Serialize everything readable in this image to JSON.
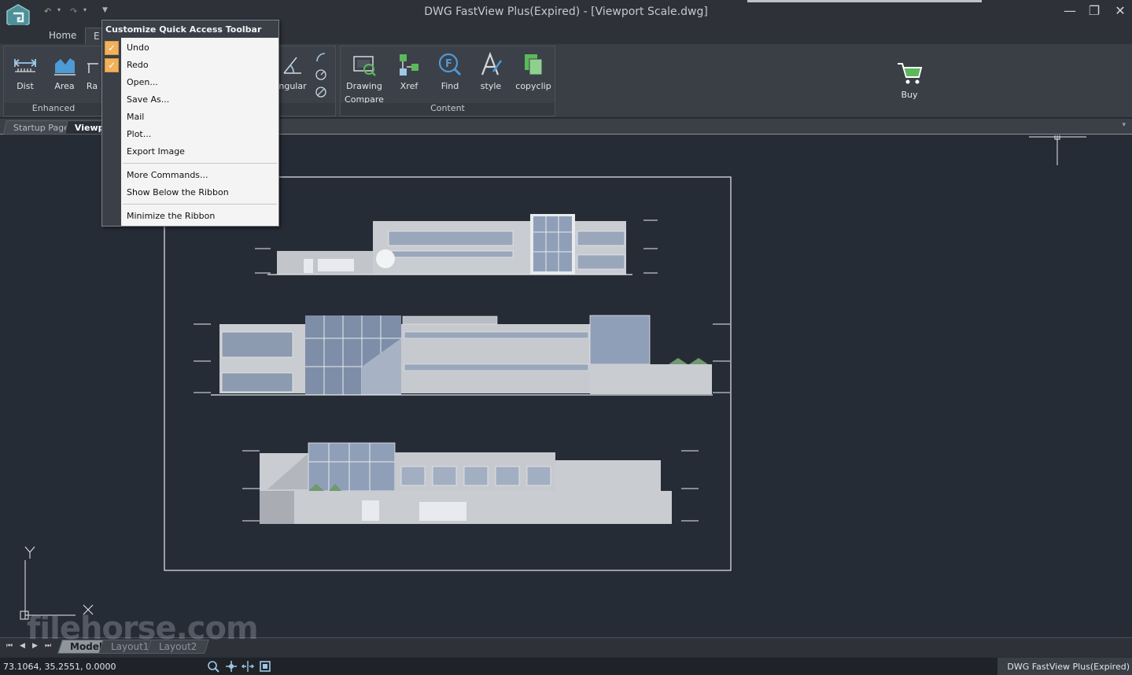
{
  "window": {
    "title": "DWG FastView Plus(Expired) - [Viewport Scale.dwg]",
    "controls": [
      "minimize",
      "restore",
      "close"
    ]
  },
  "qat": {
    "undo_icon": "undo-icon",
    "redo_icon": "redo-icon",
    "customize_icon": "customize-qat-icon"
  },
  "ribbon_tabs": [
    {
      "label": "Home"
    },
    {
      "label": "E"
    }
  ],
  "ribbon": {
    "groups": {
      "enhanced": {
        "label": "Enhanced",
        "buttons": [
          "Dist",
          "Area",
          "Ra"
        ]
      },
      "measure_tail": {
        "label": ""
      },
      "content": {
        "label": "Content",
        "buttons": [
          "Drawing Compare",
          "Xref",
          "Find",
          "style",
          "copyclip"
        ]
      }
    },
    "dist": "Dist",
    "area": "Area",
    "ra": "Ra",
    "angular": "ngular",
    "drawing_compare_1": "Drawing",
    "drawing_compare_2": "Compare",
    "xref": "Xref",
    "find": "Find",
    "style": "style",
    "copyclip": "copyclip",
    "buy": "Buy"
  },
  "doc_tabs": [
    {
      "label": "Startup Page",
      "active": false
    },
    {
      "label": "Viewpo",
      "active": true
    }
  ],
  "menu": {
    "header": "Customize Quick Access Toolbar",
    "items": [
      {
        "label": "Undo",
        "checked": true
      },
      {
        "label": "Redo",
        "checked": true
      },
      {
        "label": "Open...",
        "checked": false
      },
      {
        "label": "Save As...",
        "checked": false
      },
      {
        "label": "Mail",
        "checked": false
      },
      {
        "label": "Plot...",
        "checked": false
      },
      {
        "label": "Export Image",
        "checked": false
      },
      {
        "label": "More Commands...",
        "checked": false
      },
      {
        "label": "Show Below the Ribbon",
        "checked": false
      },
      {
        "label": "Minimize the Ribbon",
        "checked": false
      }
    ]
  },
  "ucs": {
    "y_label": "Y",
    "x_label": "X"
  },
  "layout_tabs": [
    {
      "label": "Model",
      "active": true
    },
    {
      "label": "Layout1",
      "active": false
    },
    {
      "label": "Layout2",
      "active": false
    }
  ],
  "watermark": "filehorse.com",
  "status": {
    "coords": "73.1064, 35.2551, 0.0000",
    "app_status": "DWG FastView Plus(Expired)"
  },
  "colors": {
    "canvas": "#262c36",
    "accent_green": "#5cb85c",
    "menu_check": "#f2b15b"
  }
}
